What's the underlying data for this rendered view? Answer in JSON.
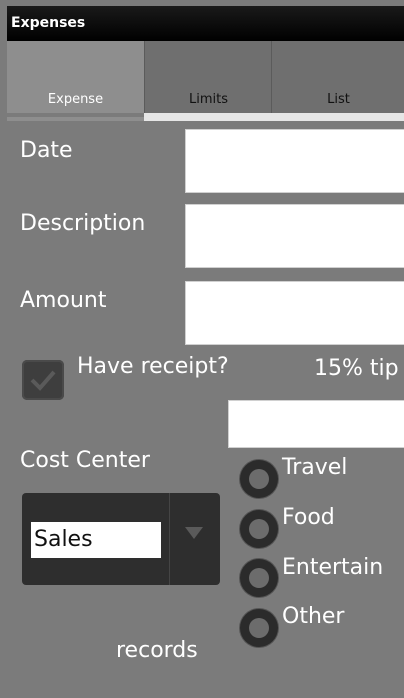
{
  "app": {
    "title": "Expenses"
  },
  "tabs": [
    {
      "label": "Expense"
    },
    {
      "label": "Limits"
    },
    {
      "label": "List"
    }
  ],
  "form": {
    "date_label": "Date",
    "description_label": "Description",
    "amount_label": "Amount",
    "receipt_label": "Have receipt?",
    "tip_label": "15% tip",
    "cost_center_label": "Cost Center",
    "cost_center_value": "Sales",
    "records_label": "records",
    "receipt_checked": true
  },
  "categories": [
    {
      "label": "Travel"
    },
    {
      "label": "Food"
    },
    {
      "label": "Entertain"
    },
    {
      "label": "Other"
    }
  ]
}
